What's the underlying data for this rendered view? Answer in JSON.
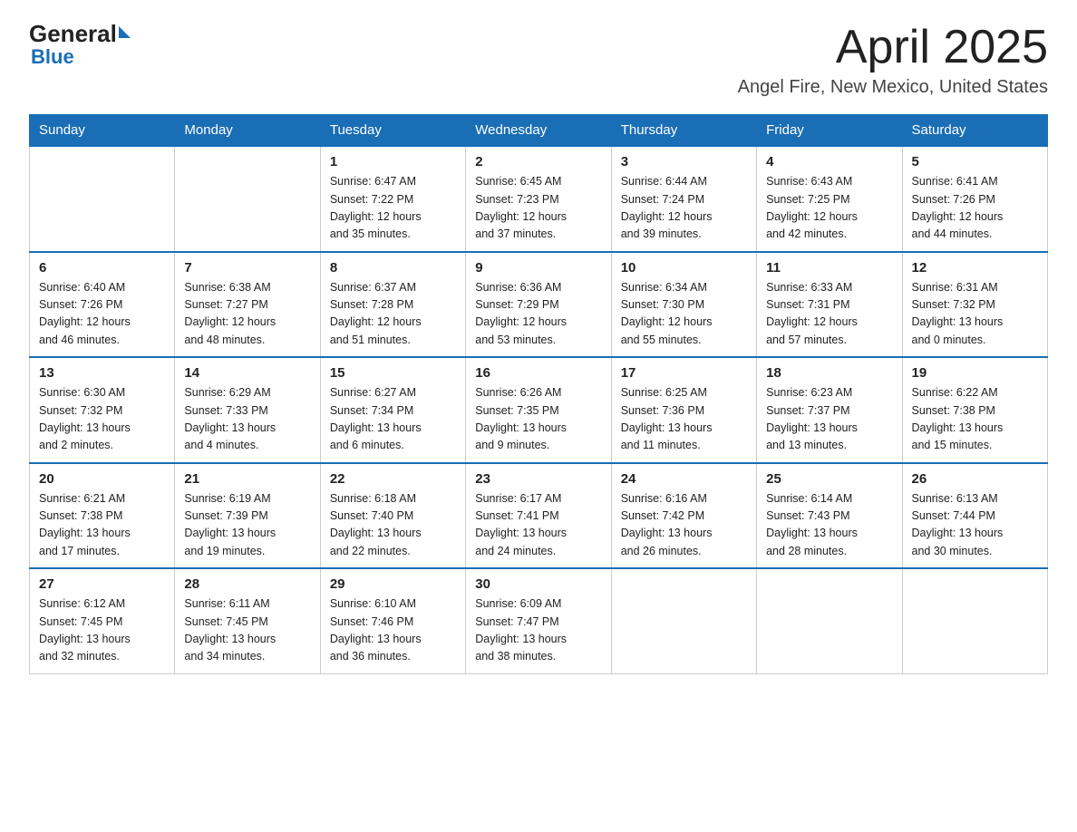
{
  "header": {
    "logo_general": "General",
    "logo_blue": "Blue",
    "main_title": "April 2025",
    "subtitle": "Angel Fire, New Mexico, United States"
  },
  "weekdays": [
    "Sunday",
    "Monday",
    "Tuesday",
    "Wednesday",
    "Thursday",
    "Friday",
    "Saturday"
  ],
  "weeks": [
    [
      {
        "day": "",
        "info": ""
      },
      {
        "day": "",
        "info": ""
      },
      {
        "day": "1",
        "info": "Sunrise: 6:47 AM\nSunset: 7:22 PM\nDaylight: 12 hours\nand 35 minutes."
      },
      {
        "day": "2",
        "info": "Sunrise: 6:45 AM\nSunset: 7:23 PM\nDaylight: 12 hours\nand 37 minutes."
      },
      {
        "day": "3",
        "info": "Sunrise: 6:44 AM\nSunset: 7:24 PM\nDaylight: 12 hours\nand 39 minutes."
      },
      {
        "day": "4",
        "info": "Sunrise: 6:43 AM\nSunset: 7:25 PM\nDaylight: 12 hours\nand 42 minutes."
      },
      {
        "day": "5",
        "info": "Sunrise: 6:41 AM\nSunset: 7:26 PM\nDaylight: 12 hours\nand 44 minutes."
      }
    ],
    [
      {
        "day": "6",
        "info": "Sunrise: 6:40 AM\nSunset: 7:26 PM\nDaylight: 12 hours\nand 46 minutes."
      },
      {
        "day": "7",
        "info": "Sunrise: 6:38 AM\nSunset: 7:27 PM\nDaylight: 12 hours\nand 48 minutes."
      },
      {
        "day": "8",
        "info": "Sunrise: 6:37 AM\nSunset: 7:28 PM\nDaylight: 12 hours\nand 51 minutes."
      },
      {
        "day": "9",
        "info": "Sunrise: 6:36 AM\nSunset: 7:29 PM\nDaylight: 12 hours\nand 53 minutes."
      },
      {
        "day": "10",
        "info": "Sunrise: 6:34 AM\nSunset: 7:30 PM\nDaylight: 12 hours\nand 55 minutes."
      },
      {
        "day": "11",
        "info": "Sunrise: 6:33 AM\nSunset: 7:31 PM\nDaylight: 12 hours\nand 57 minutes."
      },
      {
        "day": "12",
        "info": "Sunrise: 6:31 AM\nSunset: 7:32 PM\nDaylight: 13 hours\nand 0 minutes."
      }
    ],
    [
      {
        "day": "13",
        "info": "Sunrise: 6:30 AM\nSunset: 7:32 PM\nDaylight: 13 hours\nand 2 minutes."
      },
      {
        "day": "14",
        "info": "Sunrise: 6:29 AM\nSunset: 7:33 PM\nDaylight: 13 hours\nand 4 minutes."
      },
      {
        "day": "15",
        "info": "Sunrise: 6:27 AM\nSunset: 7:34 PM\nDaylight: 13 hours\nand 6 minutes."
      },
      {
        "day": "16",
        "info": "Sunrise: 6:26 AM\nSunset: 7:35 PM\nDaylight: 13 hours\nand 9 minutes."
      },
      {
        "day": "17",
        "info": "Sunrise: 6:25 AM\nSunset: 7:36 PM\nDaylight: 13 hours\nand 11 minutes."
      },
      {
        "day": "18",
        "info": "Sunrise: 6:23 AM\nSunset: 7:37 PM\nDaylight: 13 hours\nand 13 minutes."
      },
      {
        "day": "19",
        "info": "Sunrise: 6:22 AM\nSunset: 7:38 PM\nDaylight: 13 hours\nand 15 minutes."
      }
    ],
    [
      {
        "day": "20",
        "info": "Sunrise: 6:21 AM\nSunset: 7:38 PM\nDaylight: 13 hours\nand 17 minutes."
      },
      {
        "day": "21",
        "info": "Sunrise: 6:19 AM\nSunset: 7:39 PM\nDaylight: 13 hours\nand 19 minutes."
      },
      {
        "day": "22",
        "info": "Sunrise: 6:18 AM\nSunset: 7:40 PM\nDaylight: 13 hours\nand 22 minutes."
      },
      {
        "day": "23",
        "info": "Sunrise: 6:17 AM\nSunset: 7:41 PM\nDaylight: 13 hours\nand 24 minutes."
      },
      {
        "day": "24",
        "info": "Sunrise: 6:16 AM\nSunset: 7:42 PM\nDaylight: 13 hours\nand 26 minutes."
      },
      {
        "day": "25",
        "info": "Sunrise: 6:14 AM\nSunset: 7:43 PM\nDaylight: 13 hours\nand 28 minutes."
      },
      {
        "day": "26",
        "info": "Sunrise: 6:13 AM\nSunset: 7:44 PM\nDaylight: 13 hours\nand 30 minutes."
      }
    ],
    [
      {
        "day": "27",
        "info": "Sunrise: 6:12 AM\nSunset: 7:45 PM\nDaylight: 13 hours\nand 32 minutes."
      },
      {
        "day": "28",
        "info": "Sunrise: 6:11 AM\nSunset: 7:45 PM\nDaylight: 13 hours\nand 34 minutes."
      },
      {
        "day": "29",
        "info": "Sunrise: 6:10 AM\nSunset: 7:46 PM\nDaylight: 13 hours\nand 36 minutes."
      },
      {
        "day": "30",
        "info": "Sunrise: 6:09 AM\nSunset: 7:47 PM\nDaylight: 13 hours\nand 38 minutes."
      },
      {
        "day": "",
        "info": ""
      },
      {
        "day": "",
        "info": ""
      },
      {
        "day": "",
        "info": ""
      }
    ]
  ]
}
